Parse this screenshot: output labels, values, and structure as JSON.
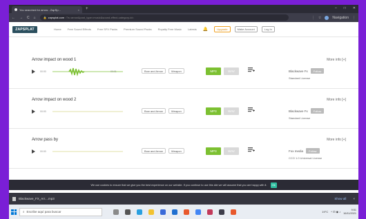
{
  "browser": {
    "tab_title": "You searched for arrow - ZapSp...",
    "tab_close": "×",
    "new_tab": "+",
    "url_host": "zapsplat.com",
    "url_path": "/?s=arrow&post_type=music&sound-effect-category-id=",
    "user": "Navigation"
  },
  "header": {
    "logo": "ZAPSPLAT",
    "nav": [
      "Home",
      "Free Sound Effects",
      "Free SFX Packs",
      "Premium Sound Packs",
      "Royalty Free Music",
      "Latests"
    ],
    "upgrade": "Upgrade",
    "make_account": "Make Account",
    "login": "Log In"
  },
  "results": [
    {
      "title": "Arrow impact on wood 1",
      "more": "More info [+]",
      "time_start": "00:00",
      "time_end": "00:01",
      "tags": [
        "Bow and Arrow",
        "Weapon"
      ],
      "mp3": "MP3",
      "wav": "WAV",
      "author": "Blackwave Fx",
      "follow": "Follow",
      "license": "Standard License",
      "has_wave": true
    },
    {
      "title": "Arrow impact on wood 2",
      "more": "More info [+]",
      "time_start": "00:00",
      "time_end": "",
      "tags": [
        "Bow and Arrow",
        "Weapon"
      ],
      "mp3": "MP3",
      "wav": "WAV",
      "author": "Blackwave Fx",
      "follow": "Follow",
      "license": "Standard License",
      "has_wave": false
    },
    {
      "title": "Arrow pass by",
      "more": "More info [+]",
      "time_start": "00:00",
      "time_end": "",
      "tags": [
        "Bow and Arrow",
        "Weapon"
      ],
      "mp3": "MP3",
      "wav": "WAV",
      "author": "Fox media",
      "follow": "Follow",
      "license": "CCO 1.0 Universal License",
      "has_wave": false
    }
  ],
  "cookie": {
    "text": "We use cookies to ensure that we give you the best experience on our website. If you continue to use this site we will assume that you are happy with it.",
    "ok": "Ok"
  },
  "download": {
    "file": "Blackwave_FX_Arr....mp3",
    "show_all": "Show all",
    "close": "×"
  },
  "taskbar": {
    "search_placeholder": "Escribe aquí para buscar",
    "temp": "19°C",
    "time": "9:51",
    "date": "16/11/2021"
  },
  "colors": {
    "accent_green": "#7cc031",
    "logo_bg": "#2b4f5e",
    "frame_bg": "#7a1fd6"
  }
}
